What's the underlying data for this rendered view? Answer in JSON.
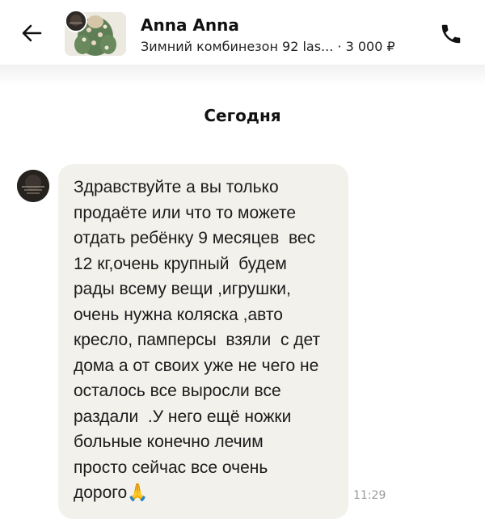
{
  "header": {
    "seller_name": "Anna Anna",
    "item_title": "Зимний комбинезон 92 las...",
    "separator": " · ",
    "price": "3 000 ₽",
    "back_icon": "arrow-left-icon",
    "call_icon": "phone-icon"
  },
  "chat": {
    "day_label": "Сегодня",
    "message": {
      "text": "Здравствуйте а вы только\nпродаёте или что то можете\nотдать ребёнку 9 месяцев  вес\n12 кг,очень крупный  будем\nрады всему вещи ,игрушки,\nочень нужна коляска ,авто\nкресло, памперсы  взяли  с дет\nдома а от своих уже не чего не\nосталось все выросли все\nраздали  .У него ещё ножки\nбольные конечно лечим\nпросто сейчас все очень\nдорого",
      "emoji": "🙏",
      "time": "11:29"
    }
  },
  "colors": {
    "bubble": "#f3f1ec",
    "text": "#111111",
    "time": "#9a9a9a"
  }
}
